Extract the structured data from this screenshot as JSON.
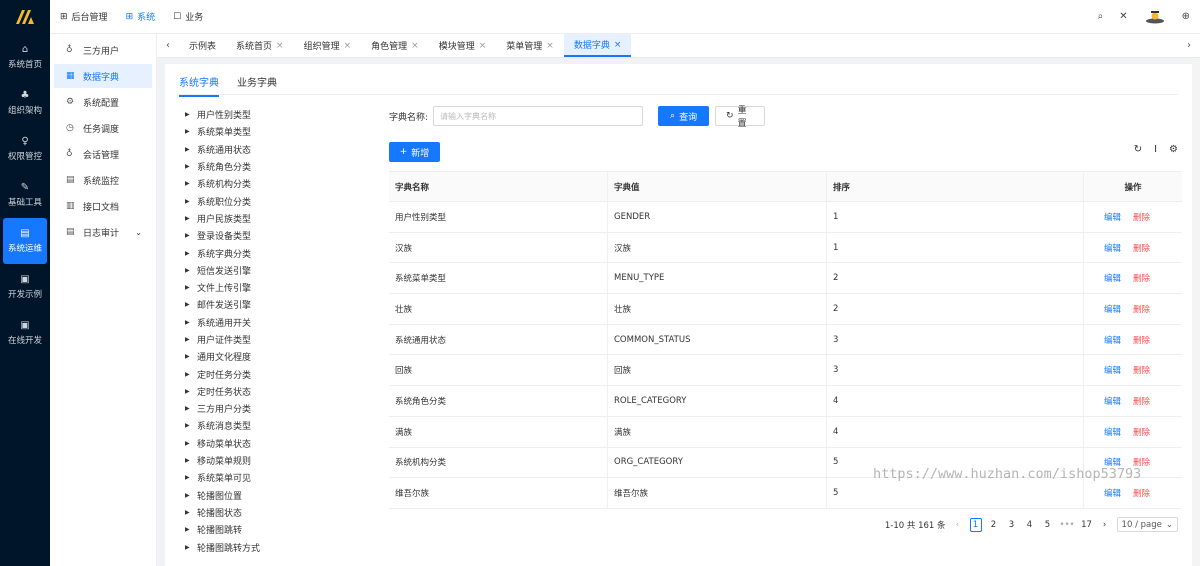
{
  "rail": {
    "items": [
      {
        "label": "系统首页",
        "icon": "home-icon",
        "glyph": "⌂"
      },
      {
        "label": "组织架构",
        "icon": "org-icon",
        "glyph": "♣"
      },
      {
        "label": "权限管控",
        "icon": "user-icon",
        "glyph": "♀"
      },
      {
        "label": "基础工具",
        "icon": "wrench-icon",
        "glyph": "✎"
      },
      {
        "label": "系统运维",
        "icon": "doc-icon",
        "glyph": "▤"
      },
      {
        "label": "开发示例",
        "icon": "window-icon",
        "glyph": "▣"
      },
      {
        "label": "在线开发",
        "icon": "window-icon",
        "glyph": "▣"
      }
    ],
    "active_index": 4
  },
  "topnav": [
    {
      "label": "后台管理",
      "glyph": "⊞"
    },
    {
      "label": "系统",
      "glyph": "⊞"
    },
    {
      "label": "业务",
      "glyph": "☐"
    }
  ],
  "topnav_active": 1,
  "topright": {
    "search": "⌕",
    "fullscreen": "✕",
    "lang": "⊕"
  },
  "submenu": [
    {
      "label": "三方用户",
      "glyph": "♁"
    },
    {
      "label": "数据字典",
      "glyph": "▦"
    },
    {
      "label": "系统配置",
      "glyph": "⚙"
    },
    {
      "label": "任务调度",
      "glyph": "◷"
    },
    {
      "label": "会话管理",
      "glyph": "♁"
    },
    {
      "label": "系统监控",
      "glyph": "▤"
    },
    {
      "label": "接口文档",
      "glyph": "▥"
    },
    {
      "label": "日志审计",
      "glyph": "▤",
      "chevron": "⌄"
    }
  ],
  "tabs": [
    {
      "label": "示例表"
    },
    {
      "label": "系统首页"
    },
    {
      "label": "组织管理"
    },
    {
      "label": "角色管理"
    },
    {
      "label": "模块管理"
    },
    {
      "label": "菜单管理"
    },
    {
      "label": "数据字典"
    }
  ],
  "tab_close": "×",
  "content_tabs": [
    {
      "label": "系统字典"
    },
    {
      "label": "业务字典"
    }
  ],
  "tree": [
    "用户性别类型",
    "系统菜单类型",
    "系统通用状态",
    "系统角色分类",
    "系统机构分类",
    "系统职位分类",
    "用户民族类型",
    "登录设备类型",
    "系统字典分类",
    "短信发送引擎",
    "文件上传引擎",
    "邮件发送引擎",
    "系统通用开关",
    "用户证件类型",
    "通用文化程度",
    "定时任务分类",
    "定时任务状态",
    "三方用户分类",
    "系统消息类型",
    "移动菜单状态",
    "移动菜单规则",
    "系统菜单可见",
    "轮播图位置",
    "轮播图状态",
    "轮播图跳转",
    "轮播图跳转方式"
  ],
  "search": {
    "label": "字典名称:",
    "placeholder": "请输入字典名称",
    "query_label": "查询",
    "reset_label": "重置"
  },
  "add_label": "新增",
  "table": {
    "headers": [
      "字典名称",
      "字典值",
      "排序",
      "操作"
    ],
    "rows": [
      {
        "name": "用户性别类型",
        "value": "GENDER",
        "sort": "1"
      },
      {
        "name": "汉族",
        "value": "汉族",
        "sort": "1"
      },
      {
        "name": "系统菜单类型",
        "value": "MENU_TYPE",
        "sort": "2"
      },
      {
        "name": "壮族",
        "value": "壮族",
        "sort": "2"
      },
      {
        "name": "系统通用状态",
        "value": "COMMON_STATUS",
        "sort": "3"
      },
      {
        "name": "回族",
        "value": "回族",
        "sort": "3"
      },
      {
        "name": "系统角色分类",
        "value": "ROLE_CATEGORY",
        "sort": "4"
      },
      {
        "name": "满族",
        "value": "满族",
        "sort": "4"
      },
      {
        "name": "系统机构分类",
        "value": "ORG_CATEGORY",
        "sort": "5"
      },
      {
        "name": "维吾尔族",
        "value": "维吾尔族",
        "sort": "5"
      }
    ],
    "edit_label": "编辑",
    "delete_label": "删除"
  },
  "pager": {
    "total": "1-10 共 161 条",
    "pages": [
      "1",
      "2",
      "3",
      "4",
      "5"
    ],
    "ellipsis": "•••",
    "last": "17",
    "page_size": "10 / page"
  },
  "watermark": "https://www.huzhan.com/ishop53793",
  "colors": {
    "primary": "#1677ff",
    "danger": "#ff4d4f",
    "rail": "#001529"
  }
}
